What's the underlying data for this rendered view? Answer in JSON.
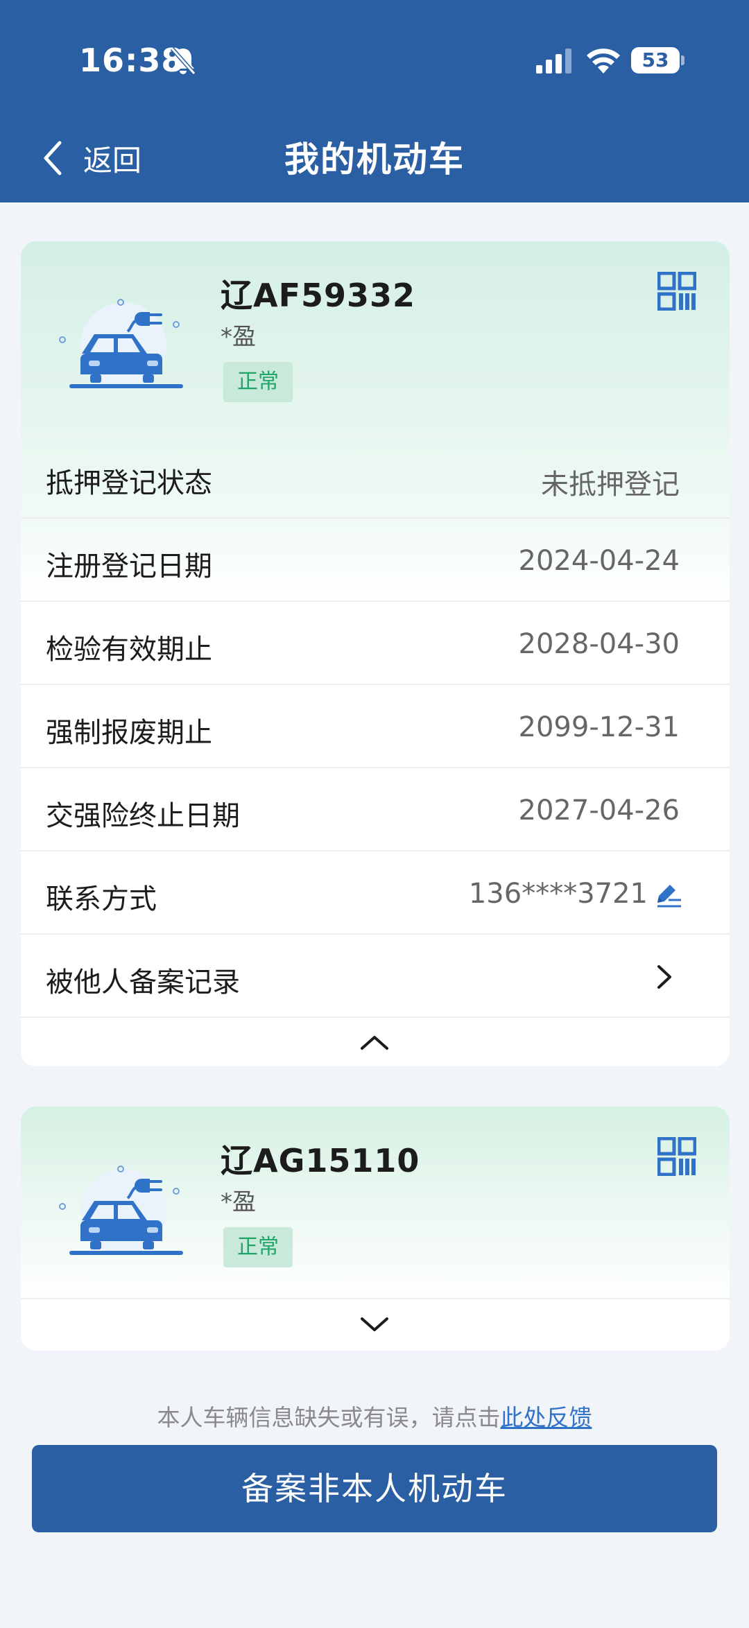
{
  "status_bar": {
    "time": "16:38",
    "battery": "53"
  },
  "nav": {
    "back_label": "返回",
    "title": "我的机动车"
  },
  "vehicles": [
    {
      "plate": "辽AF59332",
      "owner": "*盈",
      "status": "正常",
      "expanded": true,
      "details": [
        {
          "label": "抵押登记状态",
          "value": "未抵押登记"
        },
        {
          "label": "注册登记日期",
          "value": "2024-04-24"
        },
        {
          "label": "检验有效期止",
          "value": "2028-04-30"
        },
        {
          "label": "强制报废期止",
          "value": "2099-12-31"
        },
        {
          "label": "交强险终止日期",
          "value": "2027-04-26"
        },
        {
          "label": "联系方式",
          "value": "136****3721"
        },
        {
          "label": "被他人备案记录",
          "value": ""
        }
      ]
    },
    {
      "plate": "辽AG15110",
      "owner": "*盈",
      "status": "正常",
      "expanded": false
    }
  ],
  "footer": {
    "feedback_text": "本人车辆信息缺失或有误，请点击",
    "feedback_link": "此处反馈",
    "primary_button": "备案非本人机动车"
  },
  "colors": {
    "brand": "#2b5fa4",
    "status_green": "#1ea567",
    "link": "#2f72c8"
  },
  "icons": [
    "chevron-left-icon",
    "qr-code-icon",
    "electric-car-icon",
    "edit-icon",
    "chevron-right-icon",
    "chevron-up-icon",
    "chevron-down-icon",
    "bell-off-icon",
    "signal-icon",
    "wifi-icon",
    "battery-icon"
  ]
}
